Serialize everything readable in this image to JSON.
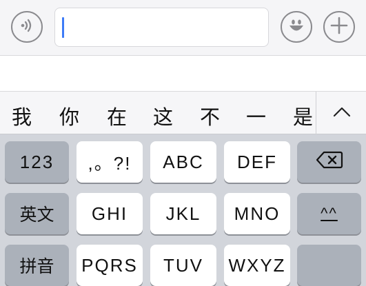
{
  "icons": {
    "voice": "voice-icon",
    "emoji": "emoji-icon",
    "add": "plus-icon",
    "delete": "delete-backspace-icon",
    "expand": "chevron-up-icon"
  },
  "input": {
    "value": ""
  },
  "candidates": [
    "我",
    "你",
    "在",
    "这",
    "不",
    "一",
    "是"
  ],
  "keys": {
    "numbers": "123",
    "punct": ",。?!",
    "abc": "ABC",
    "def": "DEF",
    "english": "英文",
    "ghi": "GHI",
    "jkl": "JKL",
    "mno": "MNO",
    "face": "^^",
    "pinyin": "拼音",
    "pqrs": "PQRS",
    "tuv": "TUV",
    "wxyz": "WXYZ"
  },
  "colors": {
    "accent_caret": "#3d7bf7",
    "function_key": "#abb1ba",
    "letter_key": "#ffffff",
    "keyboard_bg": "#d2d5db"
  }
}
